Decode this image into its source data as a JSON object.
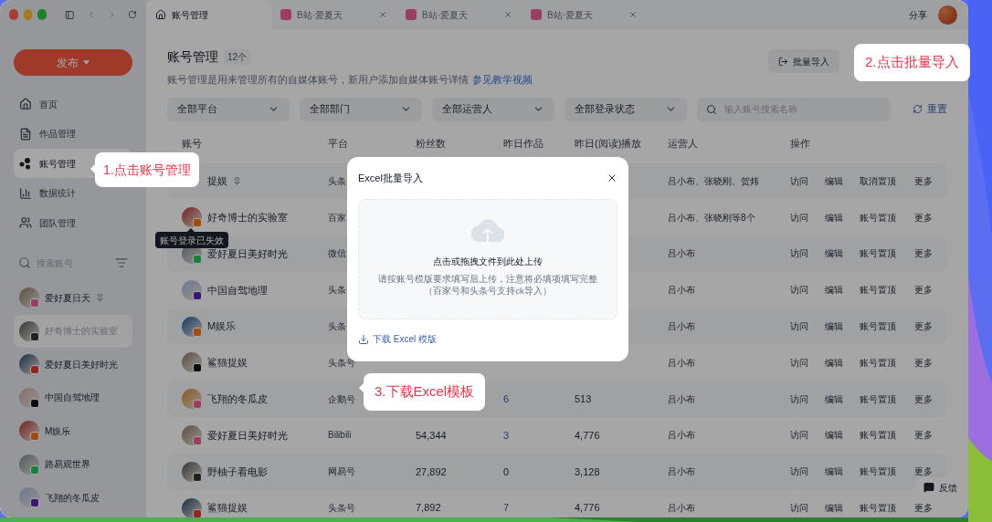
{
  "tabs": [
    {
      "label": "账号管理",
      "selected": true,
      "kind": "home",
      "closable": false
    },
    {
      "label": "B站·爱夏天",
      "selected": false,
      "kind": "site",
      "closable": true
    },
    {
      "label": "B站·爱夏天",
      "selected": false,
      "kind": "site",
      "closable": true
    },
    {
      "label": "B站·爱夏天",
      "selected": false,
      "kind": "site",
      "closable": true
    }
  ],
  "share": "分享",
  "sidebar": {
    "publish": "发布",
    "nav": [
      {
        "label": "首页",
        "kind": "home",
        "selected": false
      },
      {
        "label": "作品管理",
        "kind": "works",
        "selected": false
      },
      {
        "label": "账号管理",
        "kind": "accounts",
        "selected": true
      },
      {
        "label": "数据统计",
        "kind": "stats",
        "selected": false
      },
      {
        "label": "团队管理",
        "kind": "team",
        "selected": false
      }
    ],
    "search_placeholder": "搜索账号",
    "accounts": [
      {
        "name": "爱好夏日天",
        "pinned": true,
        "selected": false
      },
      {
        "name": "好奇博士的实验室",
        "pinned": false,
        "selected": true
      },
      {
        "name": "爱好夏日美好时光",
        "pinned": false,
        "selected": false
      },
      {
        "name": "中国自驾地理",
        "pinned": false,
        "selected": false
      },
      {
        "name": "M娱乐",
        "pinned": false,
        "selected": false
      },
      {
        "name": "路易观世界",
        "pinned": false,
        "selected": false
      },
      {
        "name": "飞翔的冬瓜皮",
        "pinned": false,
        "selected": false
      }
    ]
  },
  "header": {
    "title": "账号管理",
    "count": "12个",
    "description": "账号管理是用来管理所有的自媒体账号，新用户添加自媒体账号详情",
    "link": "参见教学视频",
    "import_button": "批量导入"
  },
  "filters": [
    "全部平台",
    "全部部门",
    "全部运营人",
    "全部登录状态"
  ],
  "search": {
    "placeholder": "输入账号搜索名称"
  },
  "reset": "重置",
  "table": {
    "columns": [
      "账号",
      "平台",
      "粉丝数",
      "昨日作品",
      "昨日(阅读)播放",
      "运营人",
      "操作"
    ],
    "rows": [
      {
        "avatar": false,
        "name": "捉娱",
        "pinned": true,
        "platform": "头条",
        "operators": "吕小布、张晓刚、贺炜",
        "actions": [
          "访问",
          "编辑",
          "取消置顶",
          "更多"
        ]
      },
      {
        "avatar": true,
        "name": "好奇博士的实验室",
        "pinned": false,
        "platform": "百家",
        "operators": "吕小布、张晓刚等8个",
        "actions": [
          "访问",
          "编辑",
          "账号置顶",
          "更多"
        ]
      },
      {
        "avatar": true,
        "name": "爱好夏日美好时光",
        "pinned": false,
        "platform": "微信",
        "operators": "吕小布",
        "actions": [
          "访问",
          "编辑",
          "账号置顶",
          "更多"
        ]
      },
      {
        "avatar": true,
        "name": "中国自驾地理",
        "pinned": false,
        "platform": "头条",
        "operators": "吕小布",
        "actions": [
          "访问",
          "编辑",
          "账号置顶",
          "更多"
        ]
      },
      {
        "avatar": true,
        "name": "M娱乐",
        "pinned": false,
        "platform": "头条",
        "operators": "吕小布",
        "actions": [
          "访问",
          "编辑",
          "账号置顶",
          "更多"
        ]
      },
      {
        "avatar": true,
        "name": "鲨猫捉娱",
        "pinned": false,
        "platform": "头条号",
        "operators": "吕小布",
        "actions": [
          "访问",
          "编辑",
          "账号置顶",
          "更多"
        ]
      },
      {
        "avatar": true,
        "name": "飞翔的冬瓜皮",
        "pinned": false,
        "platform": "企鹅号",
        "works": "6",
        "works_link": true,
        "plays": "513",
        "operators": "吕小布",
        "actions": [
          "访问",
          "编辑",
          "账号置顶",
          "更多"
        ]
      },
      {
        "avatar": true,
        "name": "爱好夏日美好时光",
        "pinned": false,
        "platform": "Bilibili",
        "fans": "54,344",
        "works": "3",
        "works_link": true,
        "plays": "4,776",
        "operators": "吕小布",
        "actions": [
          "访问",
          "编辑",
          "账号置顶",
          "更多"
        ]
      },
      {
        "avatar": true,
        "name": "野柚子看电影",
        "pinned": false,
        "platform": "网易号",
        "fans": "27,892",
        "works": "0",
        "works_link": false,
        "plays": "3,128",
        "operators": "吕小布",
        "actions": [
          "访问",
          "编辑",
          "账号置顶",
          "更多"
        ]
      },
      {
        "avatar": true,
        "name": "鲨猫捉娱",
        "pinned": false,
        "platform": "头条号",
        "fans": "7,892",
        "works": "7",
        "works_link": true,
        "plays": "4,776",
        "operators": "吕小布",
        "actions": [
          "访问",
          "编辑",
          "账号置顶",
          "更多"
        ]
      }
    ]
  },
  "tooltip": "账号登录已失效",
  "feedback": "反馈",
  "modal": {
    "title": "Excel批量导入",
    "upload_title": "点击或拖拽文件到此处上传",
    "hint": [
      "请按账号模版要求填写后上传，注意将必填项填写完整",
      "（百家号和头条号支持ck导入）"
    ],
    "download": "下载 Excel 模版"
  },
  "callouts": [
    "1.点击账号管理",
    "2.点击批量导入",
    "3.下载Excel模板"
  ]
}
